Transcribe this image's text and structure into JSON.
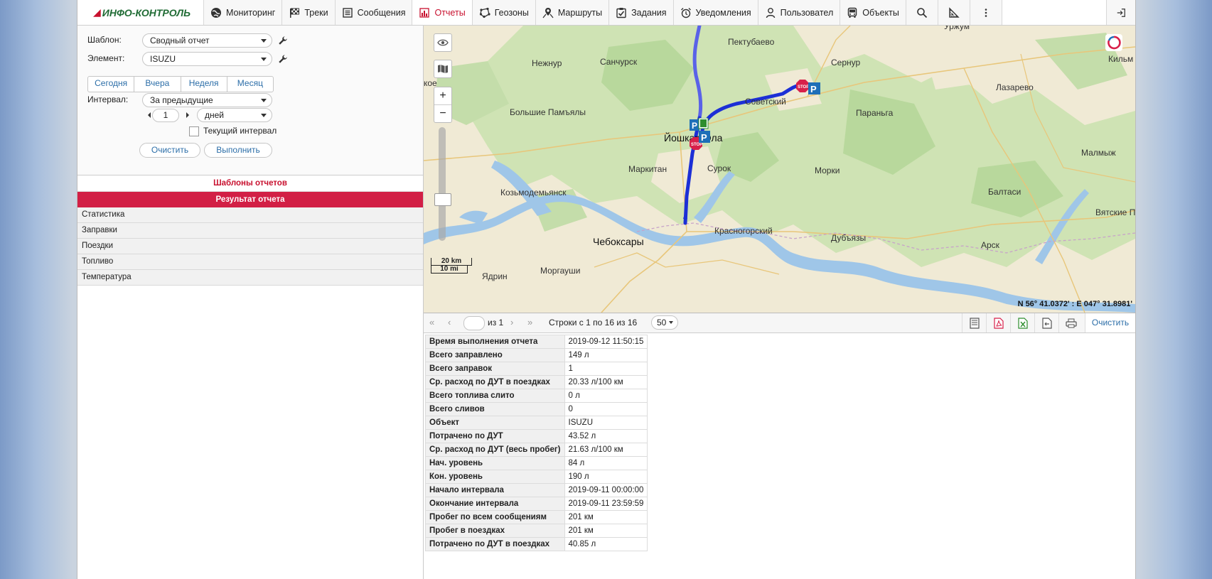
{
  "logo": {
    "mark": "◢",
    "text": "ИНФО-КОНТРОЛЬ"
  },
  "nav": [
    {
      "label": "Мониторинг",
      "icon": "globe-icon"
    },
    {
      "label": "Треки",
      "icon": "checkered-flag-icon"
    },
    {
      "label": "Сообщения",
      "icon": "list-icon"
    },
    {
      "label": "Отчеты",
      "icon": "bar-chart-icon"
    },
    {
      "label": "Геозоны",
      "icon": "polygon-icon"
    },
    {
      "label": "Маршруты",
      "icon": "route-icon"
    },
    {
      "label": "Задания",
      "icon": "task-check-icon"
    },
    {
      "label": "Уведомления",
      "icon": "alarm-clock-icon"
    },
    {
      "label": "Пользовател",
      "icon": "user-icon"
    },
    {
      "label": "Объекты",
      "icon": "bus-icon"
    }
  ],
  "colors": {
    "accent": "#d21f45",
    "link": "#2c6ea8",
    "track": "#1c2fd6"
  },
  "form": {
    "template_label": "Шаблон:",
    "template_value": "Сводный отчет",
    "element_label": "Элемент:",
    "element_value": "ISUZU",
    "quick": [
      "Сегодня",
      "Вчера",
      "Неделя",
      "Месяц"
    ],
    "interval_label": "Интервал:",
    "interval_value": "За предыдущие",
    "count_value": "1",
    "unit_value": "дней",
    "current_interval_label": "Текущий интервал",
    "current_interval_checked": false,
    "clear_label": "Очистить",
    "run_label": "Выполнить"
  },
  "templates_header": "Шаблоны отчетов",
  "result_header": "Результат отчета",
  "result_items": [
    "Статистика",
    "Заправки",
    "Поездки",
    "Топливо",
    "Температура"
  ],
  "map": {
    "towns": [
      {
        "name": "Уржум"
      },
      {
        "name": "Пектубаево"
      },
      {
        "name": "Нежнур"
      },
      {
        "name": "Санчурск"
      },
      {
        "name": "Сернур"
      },
      {
        "name": "Кильм"
      },
      {
        "name": "Лазарево"
      },
      {
        "name": "Большие Памъялы"
      },
      {
        "name": "Советский"
      },
      {
        "name": "Параньга"
      },
      {
        "name": "Йошкар-Ола"
      },
      {
        "name": "Малмыж"
      },
      {
        "name": "Маркитан"
      },
      {
        "name": "Сурок"
      },
      {
        "name": "Морки"
      },
      {
        "name": "Козьмодемьянск"
      },
      {
        "name": "Балтаси"
      },
      {
        "name": "Вятские П"
      },
      {
        "name": "Красногорский"
      },
      {
        "name": "Чебоксары"
      },
      {
        "name": "Дубъязы"
      },
      {
        "name": "Арск"
      },
      {
        "name": "Ядрин"
      },
      {
        "name": "Моргауши"
      },
      {
        "name": "кое"
      }
    ],
    "scale_km": "20 km",
    "scale_mi": "10 mi",
    "coords": "N 56° 41.0372' : E 047° 31.8981'"
  },
  "grid": {
    "page_of": "из 1",
    "rows_info": "Строки с 1 по 16 из 16",
    "page_size": "50",
    "clear_label": "Очистить"
  },
  "report": [
    {
      "k": "Время выполнения отчета",
      "v": "2019-09-12 11:50:15"
    },
    {
      "k": "Всего заправлено",
      "v": "149 л"
    },
    {
      "k": "Всего заправок",
      "v": "1"
    },
    {
      "k": "Ср. расход по ДУТ в поездках",
      "v": "20.33 л/100 км"
    },
    {
      "k": "Всего топлива слито",
      "v": "0 л"
    },
    {
      "k": "Всего сливов",
      "v": "0"
    },
    {
      "k": "Объект",
      "v": "ISUZU"
    },
    {
      "k": "Потрачено по ДУТ",
      "v": "43.52 л"
    },
    {
      "k": "Ср. расход по ДУТ (весь пробег)",
      "v": "21.63 л/100 км"
    },
    {
      "k": "Нач. уровень",
      "v": "84 л"
    },
    {
      "k": "Кон. уровень",
      "v": "190 л"
    },
    {
      "k": "Начало интервала",
      "v": "2019-09-11 00:00:00"
    },
    {
      "k": "Окончание интервала",
      "v": "2019-09-11 23:59:59"
    },
    {
      "k": "Пробег по всем сообщениям",
      "v": "201 км"
    },
    {
      "k": "Пробег в поездках",
      "v": "201 км"
    },
    {
      "k": "Потрачено по ДУТ в поездках",
      "v": "40.85 л"
    }
  ]
}
